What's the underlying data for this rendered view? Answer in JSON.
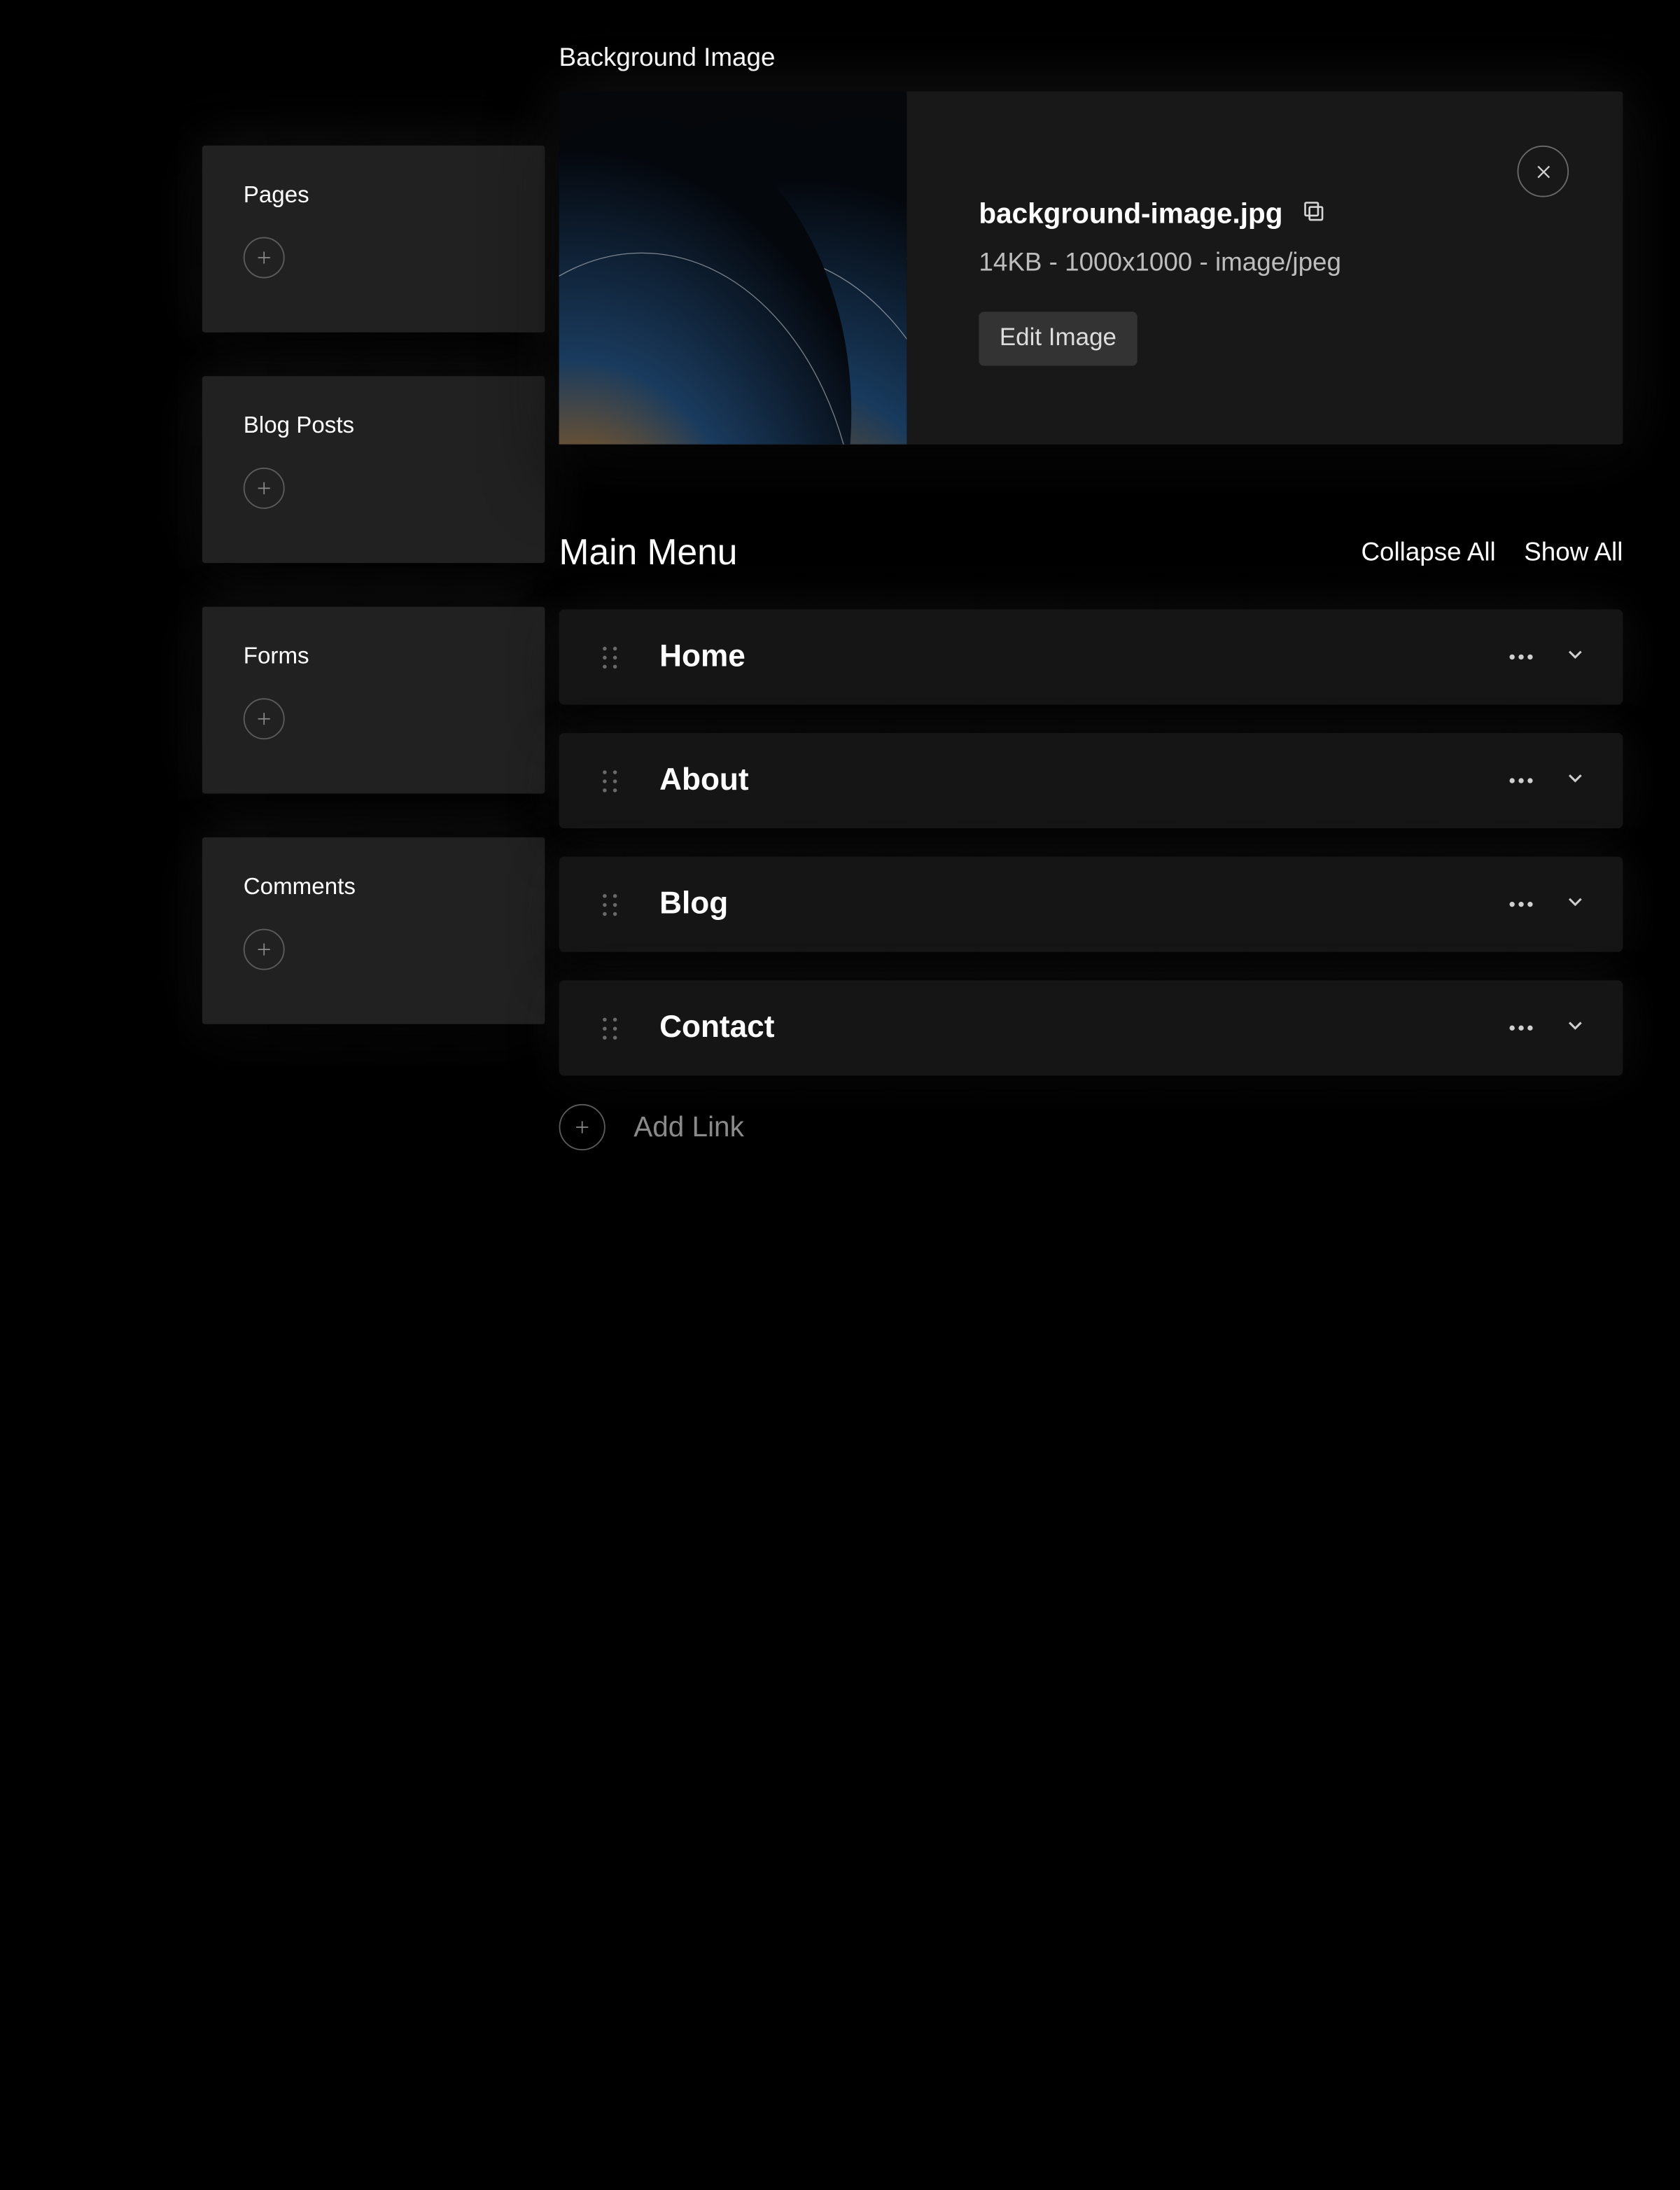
{
  "sidebar": {
    "cards": [
      {
        "title": "Pages"
      },
      {
        "title": "Blog Posts"
      },
      {
        "title": "Forms"
      },
      {
        "title": "Comments"
      }
    ]
  },
  "background_image": {
    "section_label": "Background Image",
    "filename": "background-image.jpg",
    "meta": "14KB - 1000x1000 - image/jpeg",
    "edit_label": "Edit Image"
  },
  "main_menu": {
    "title": "Main Menu",
    "collapse_label": "Collapse All",
    "show_all_label": "Show All",
    "items": [
      {
        "label": "Home"
      },
      {
        "label": "About"
      },
      {
        "label": "Blog"
      },
      {
        "label": "Contact"
      }
    ],
    "add_link_label": "Add Link"
  }
}
